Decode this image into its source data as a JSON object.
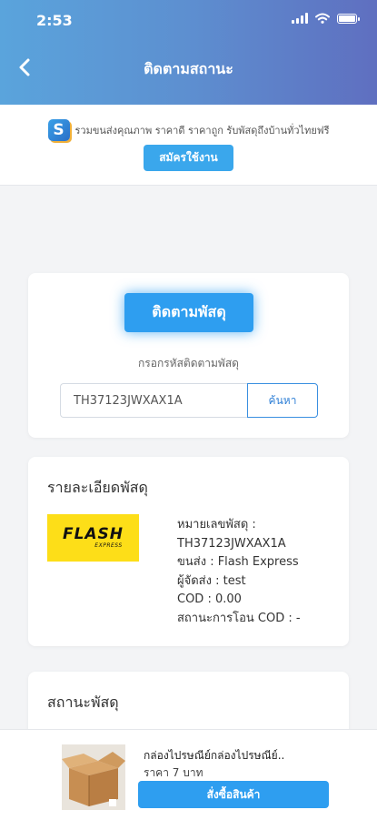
{
  "status_bar": {
    "time": "2:53"
  },
  "header": {
    "title": "ติดตามสถานะ"
  },
  "promo": {
    "text": "รวมขนส่งคุณภาพ ราคาดี ราคาถูก รับพัสดุถึงบ้านทั่วไทยฟรี",
    "register_label": "สมัครใช้งาน"
  },
  "tracking": {
    "button_label": "ติดตามพัสดุ",
    "hint": "กรอกรหัสติดตามพัสดุ",
    "input_value": "TH37123JWXAX1A",
    "search_label": "ค้นหา"
  },
  "details": {
    "heading": "รายละเอียดพัสดุ",
    "logo_text": "FLASH",
    "logo_sub": "EXPRESS",
    "lines": [
      "หมายเลขพัสดุ :",
      "TH37123JWXAX1A",
      "ขนส่ง : Flash Express",
      "ผู้จัดส่ง : test",
      "COD : 0.00",
      "สถานะการโอน COD : -"
    ]
  },
  "status_section": {
    "heading": "สถานะพัสดุ"
  },
  "product": {
    "name": "กล่องไปรษณีย์กล่องไปรษณีย์..",
    "price": "ราคา 7 บาท",
    "buy_label": "สั่งซื้อสินค้า"
  },
  "colors": {
    "header_gradient": [
      "#5aa4dc",
      "#5f6fc0"
    ],
    "accent": "#2e9ef0",
    "flash_yellow": "#fdde18"
  },
  "icons": [
    "back-arrow-icon",
    "wifi-icon",
    "signal-icon",
    "battery-icon",
    "app-logo-icon"
  ]
}
